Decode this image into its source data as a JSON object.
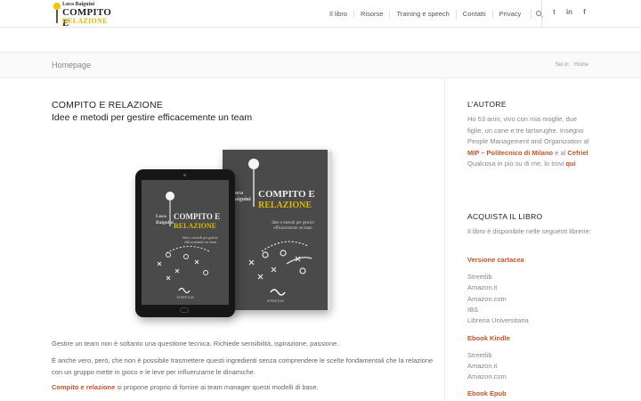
{
  "logo": {
    "author": "Luca Baiguini",
    "title_line1": "COMPITO E",
    "title_line2": "RELAZIONE"
  },
  "nav": {
    "items": [
      "Il libro",
      "Risorse",
      "Training e speech",
      "Contatti",
      "Privacy"
    ]
  },
  "social": {
    "twitter": "t",
    "linkedin": "in",
    "facebook": "f"
  },
  "titlebar": {
    "page_title": "Homepage",
    "breadcrumb_prefix": "Sei in:",
    "breadcrumb_current": "Home"
  },
  "main": {
    "heading": "COMPITO E RELAZIONE",
    "subheading": "Idee e metodi per gestire efficacemente un team",
    "paragraph1": "Gestire un team non è soltanto una questione tecnica. Richiede sensibilità, ispirazione, passione.",
    "paragraph2": "È anche vero, però, che non è possibile trasmettere questi ingredienti senza comprendere le scelte fondamentali che la relazione con un gruppo mette in gioco e le leve per influenzarne le dinamiche.",
    "paragraph3_link": "Compito e relazione",
    "paragraph3_rest": " si propone proprio di fornire ai team manager questi modelli di base."
  },
  "cover": {
    "title1": "COMPITO E",
    "title2": "RELAZIONE",
    "author1": "Luca",
    "author2": "Baiguini",
    "subtitle": "Idee e metodi per gestire efficacemente un team",
    "publisher": "STREETLIB"
  },
  "sidebar": {
    "author_heading": "L’AUTORE",
    "author_text1": "Ho 53 anni, vivo con mia moglie, due figlie, un cane e tre tartarughe.",
    "author_text2": "Insegno People Management and Organization al",
    "author_link1": "MIP – Politecnico di Milano",
    "author_text3": " e al ",
    "author_link2": "Cefriel",
    "author_text4": "Qualcosa in più su di me, lo trovi ",
    "author_link3": "qui",
    "buy_heading": "ACQUISTA IL LIBRO",
    "buy_text": "Il libro è disponibile nelle seguenti librerie:",
    "print_heading": "Versione cartacea",
    "print_stores": [
      "Streetlib",
      "Amazon.it",
      "Amazon.com",
      "IBS",
      "Libreria Universitaria"
    ],
    "kindle_heading": "Ebook Kindle",
    "kindle_stores": [
      "Streetlib",
      "Amazon.it",
      "Amazon.com"
    ],
    "epub_heading": "Ebook Epub"
  },
  "colors": {
    "accent": "#c0552a",
    "logo_yellow": "#e0b800"
  }
}
